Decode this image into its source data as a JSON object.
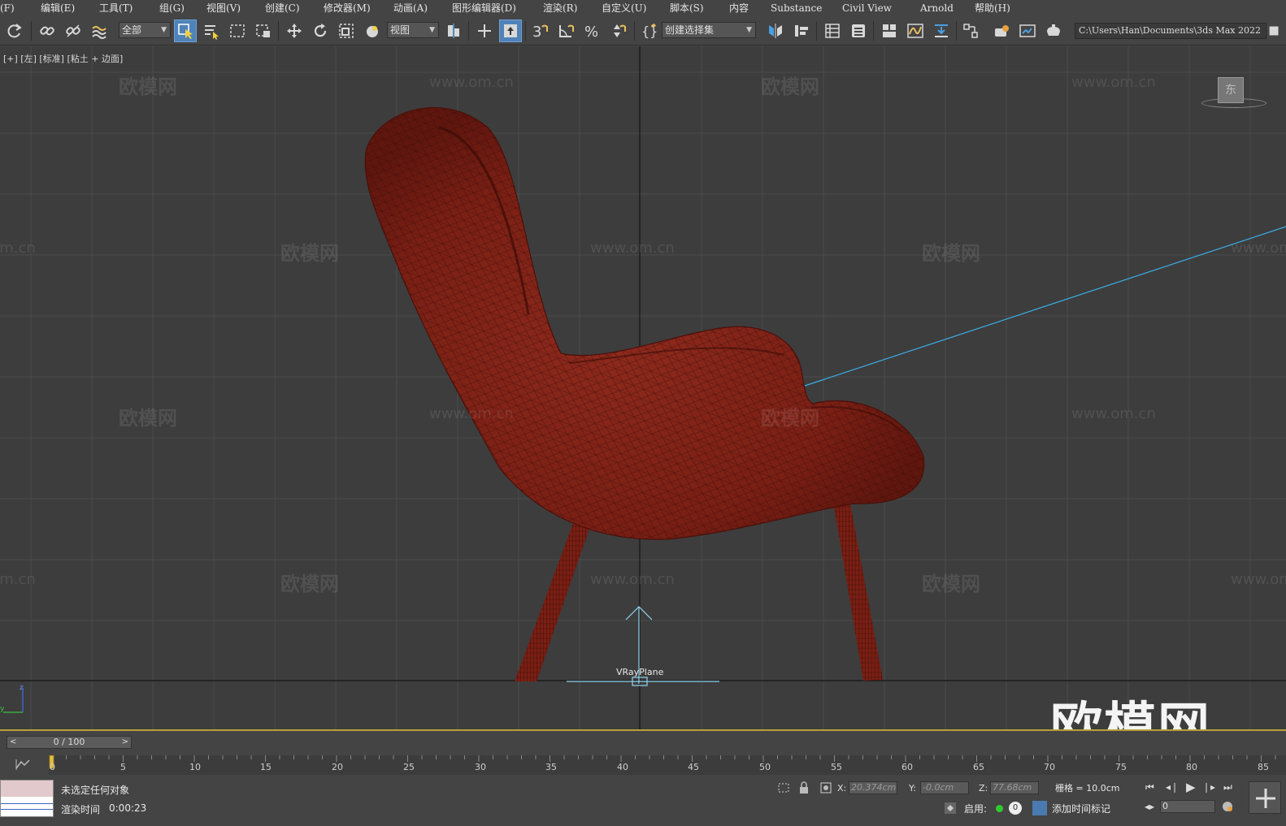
{
  "menu": [
    "(F)",
    "编辑(E)",
    "工具(T)",
    "组(G)",
    "视图(V)",
    "创建(C)",
    "修改器(M)",
    "动画(A)",
    "图形编辑器(D)",
    "渲染(R)",
    "自定义(U)",
    "脚本(S)",
    "内容",
    "Substance",
    "Civil View",
    "Arnold",
    "帮助(H)"
  ],
  "toolbar": {
    "filter_value": "全部",
    "refcoord_value": "视图",
    "selection_set_value": "创建选择集",
    "project_path": "C:\\Users\\Han\\Documents\\3ds Max 2022"
  },
  "viewport": {
    "label": "[+] [左] [标准] [粘土 + 边面]",
    "object_label": "VRayPlane",
    "viewcube_face": "东",
    "watermark_cn": "欧模网",
    "watermark_url": "www.om.cn",
    "logo_text": "欧模网",
    "chair_color": "#8c2318",
    "line_color": "#3aaee8"
  },
  "timeline": {
    "frame_display": "0 / 100",
    "ticks": [
      "0",
      "5",
      "10",
      "15",
      "20",
      "25",
      "30",
      "35",
      "40",
      "45",
      "50",
      "55",
      "60",
      "65",
      "70",
      "75",
      "80",
      "85"
    ]
  },
  "status": {
    "selection": "未选定任何对象",
    "render_time_label": "渲染时间",
    "render_time_value": "0:00:23",
    "x_label": "X:",
    "x_value": "20.374cm",
    "y_label": "Y:",
    "y_value": "-0.0cm",
    "z_label": "Z:",
    "z_value": "77.68cm",
    "grid": "栅格 = 10.0cm",
    "enable_label": "启用:",
    "enable_count": "0",
    "add_time_tag": "添加时间标记",
    "current_frame": "0"
  }
}
